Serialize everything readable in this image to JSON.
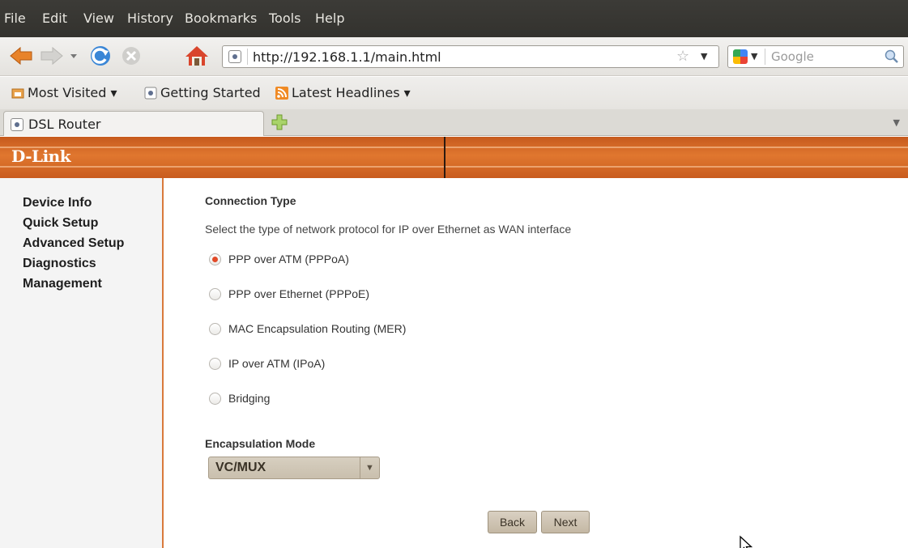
{
  "menu": [
    "File",
    "Edit",
    "View",
    "History",
    "Bookmarks",
    "Tools",
    "Help"
  ],
  "navbar": {
    "url": "http://192.168.1.1/main.html",
    "search_placeholder": "Google"
  },
  "bookmarks": [
    "Most Visited ▾",
    "Getting Started",
    "Latest Headlines ▾"
  ],
  "tab": {
    "title": "DSL Router"
  },
  "header": {
    "logo": "D-Link"
  },
  "leftnav": [
    "Device Info",
    "Quick Setup",
    "Advanced Setup",
    "Diagnostics",
    "Management"
  ],
  "main": {
    "connection_heading": "Connection Type",
    "description": "Select the type of network protocol for IP over Ethernet as WAN interface",
    "options": [
      {
        "label": "PPP over ATM (PPPoA)",
        "selected": true
      },
      {
        "label": "PPP over Ethernet (PPPoE)",
        "selected": false
      },
      {
        "label": "MAC Encapsulation Routing (MER)",
        "selected": false
      },
      {
        "label": "IP over ATM (IPoA)",
        "selected": false
      },
      {
        "label": "Bridging",
        "selected": false
      }
    ],
    "encap_heading": "Encapsulation Mode",
    "encap_value": "VC/MUX",
    "back_label": "Back",
    "next_label": "Next"
  },
  "colors": {
    "accent_orange": "#e0772f",
    "radio_selected": "#e24a28"
  }
}
